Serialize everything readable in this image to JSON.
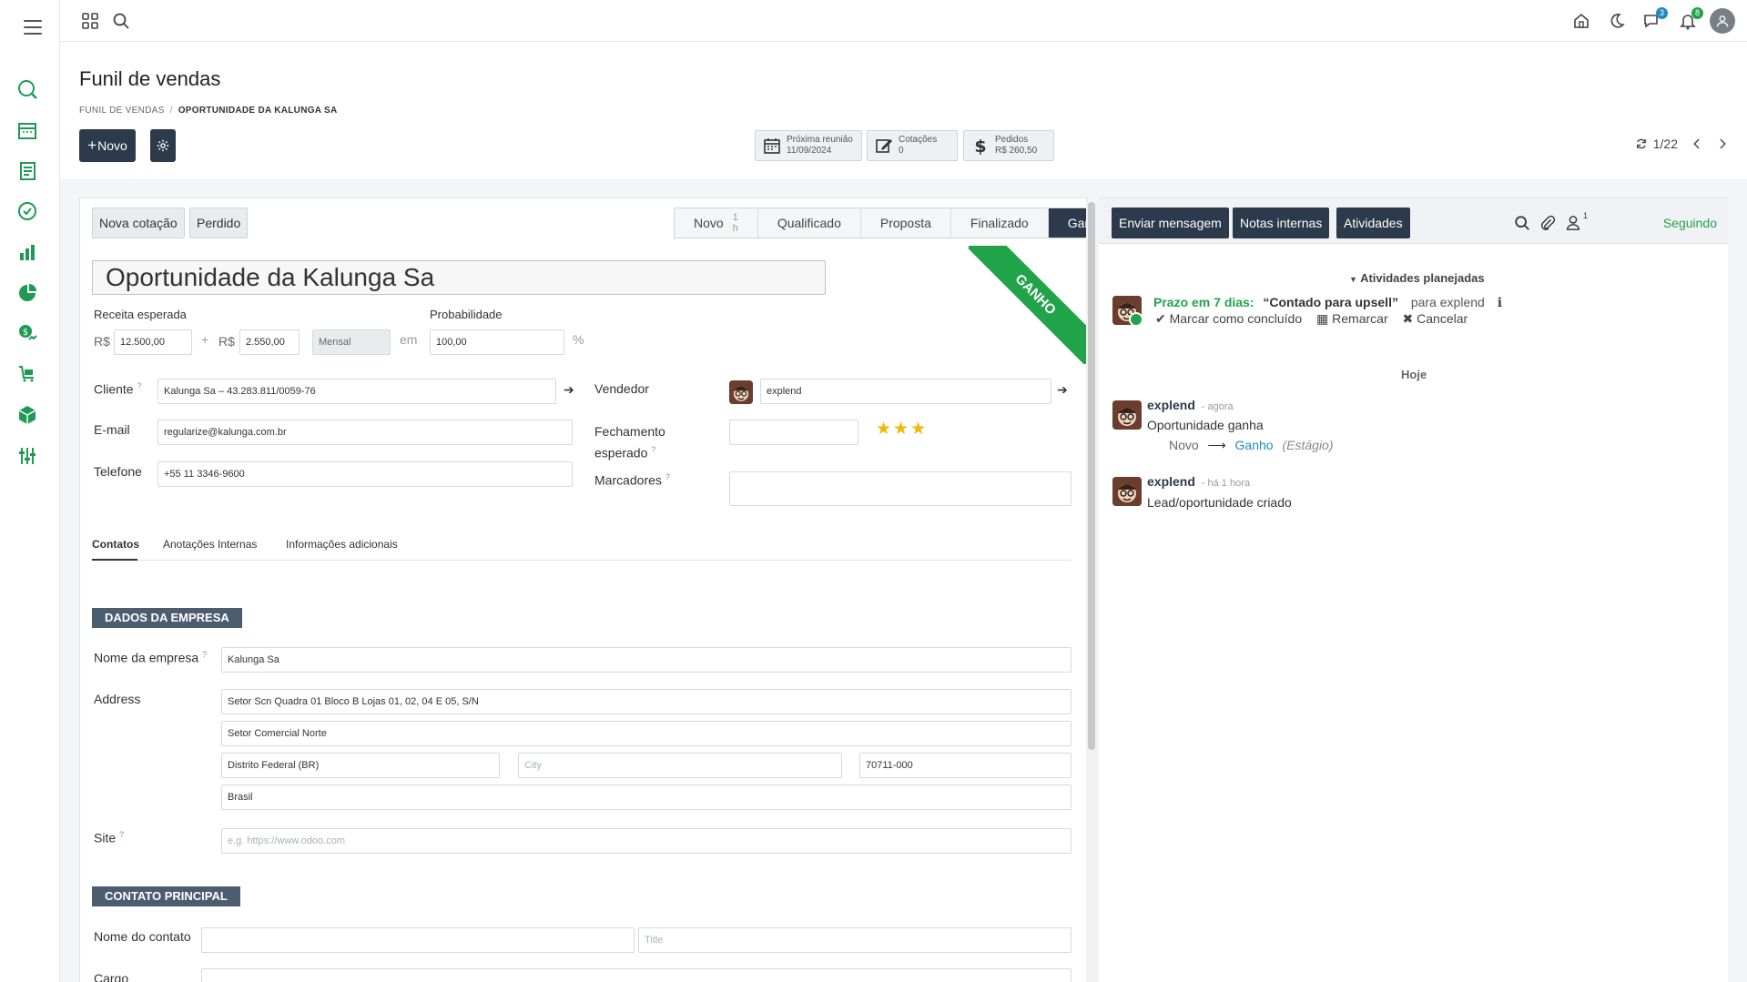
{
  "topbar": {
    "discuss_badge": "3",
    "activity_badge": "8"
  },
  "control": {
    "title": "Funil de vendas",
    "breadcrumb": [
      "Funil de vendas",
      "Oportunidade da Kalunga Sa"
    ],
    "new_label": "Novo",
    "smart_buttons": [
      {
        "label": "Próxima reunião",
        "value": "11/09/2024",
        "icon": "calendar-icon"
      },
      {
        "label": "Cotações",
        "value": "0",
        "icon": "edit-icon"
      },
      {
        "label": "Pedidos",
        "value": "R$ 260,50",
        "icon": "dollar-icon"
      }
    ],
    "pager": "1/22"
  },
  "form": {
    "buttons": {
      "quote": "Nova cotação",
      "lost": "Perdido"
    },
    "stages": [
      {
        "label": "Novo",
        "duration": "1 h"
      },
      {
        "label": "Qualificado"
      },
      {
        "label": "Proposta"
      },
      {
        "label": "Finalizado"
      },
      {
        "label": "Ganho",
        "active": true
      }
    ],
    "ribbon": "GANHO",
    "name": "Oportunidade da Kalunga Sa",
    "expected_revenue_label": "Receita esperada",
    "currency": "R$",
    "expected_revenue": "12.500,00",
    "plus": "+",
    "recurring_revenue": "2.550,00",
    "recurring_plan": "Mensal",
    "em": "em",
    "probability_label": "Probabilidade",
    "probability": "100,00",
    "percent": "%",
    "customer_label": "Cliente",
    "customer": "Kalunga Sa – 43.283.811/0059-76",
    "email_label": "E-mail",
    "email": "regularize@kalunga.com.br",
    "phone_label": "Telefone",
    "phone": "+55 11 3346-9600",
    "salesperson_label": "Vendedor",
    "salesperson": "explend",
    "closing_label_1": "Fechamento",
    "closing_label_2": "esperado",
    "tags_label": "Marcadores",
    "priority_stars": 3,
    "tabs": [
      "Contatos",
      "Anotações Internas",
      "Informações adicionais"
    ],
    "company_section": "Dados da empresa",
    "company_name_label": "Nome da empresa",
    "company_name": "Kalunga Sa",
    "address_label": "Address",
    "street": "Setor Scn Quadra 01 Bloco B Lojas 01, 02, 04 E 05, S/N",
    "street2": "Setor Comercial Norte",
    "state": "Distrito Federal (BR)",
    "city_placeholder": "City",
    "zip": "70711-000",
    "country": "Brasil",
    "site_label": "Site",
    "site_placeholder": "e.g. https://www.odoo.com",
    "contact_section": "Contato principal",
    "contact_name_label": "Nome do contato",
    "title_placeholder": "Title",
    "job_label": "Cargo"
  },
  "chatter": {
    "send_message": "Enviar mensagem",
    "log_note": "Notas internas",
    "activities": "Atividades",
    "followers_count": "1",
    "following": "Seguindo",
    "planned_title": "Atividades planejadas",
    "activity": {
      "due": "Prazo em 7 dias:",
      "summary": "“Contado para upsell”",
      "for": "para explend",
      "done": "Marcar como concluído",
      "reschedule": "Remarcar",
      "cancel": "Cancelar"
    },
    "today": "Hoje",
    "messages": [
      {
        "author": "explend",
        "time": "- agora",
        "body": "Oportunidade ganha",
        "from": "Novo",
        "to": "Ganho",
        "field": "(Estágio)"
      },
      {
        "author": "explend",
        "time": "- há 1 hora",
        "body": "Lead/oportunidade criado"
      }
    ]
  },
  "colors": {
    "primary": "#2d3a4b",
    "success": "#21a34a",
    "link": "#1f8ac0",
    "section": "#4d5d70"
  }
}
